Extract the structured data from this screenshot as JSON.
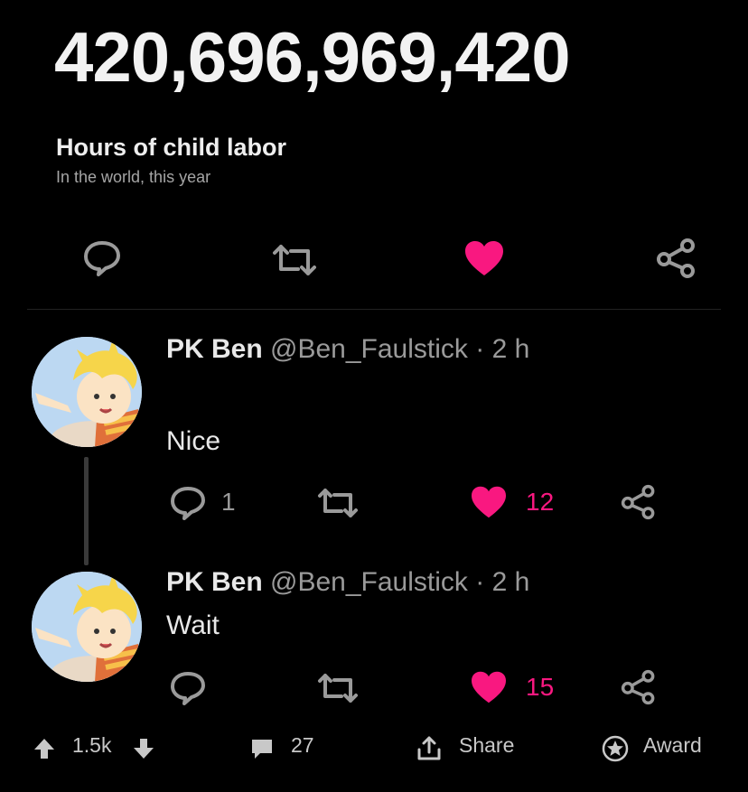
{
  "stat": {
    "number": "420,696,969,420",
    "title": "Hours of child labor",
    "subtitle": "In the world, this year"
  },
  "tweets": [
    {
      "name": "PK Ben",
      "handle": "@Ben_Faulstick",
      "time": "· 2 h",
      "text": "Nice",
      "reply_count": "1",
      "like_count": "12"
    },
    {
      "name": "PK Ben",
      "handle": "@Ben_Faulstick",
      "time": "· 2 h",
      "text": "Wait",
      "reply_count": "",
      "like_count": "15"
    }
  ],
  "bottom": {
    "votes": "1.5k",
    "comments": "27",
    "share": "Share",
    "award": "Award"
  },
  "colors": {
    "like": "#f91880",
    "icon_grey": "#9a9a9a",
    "background": "#000000"
  }
}
